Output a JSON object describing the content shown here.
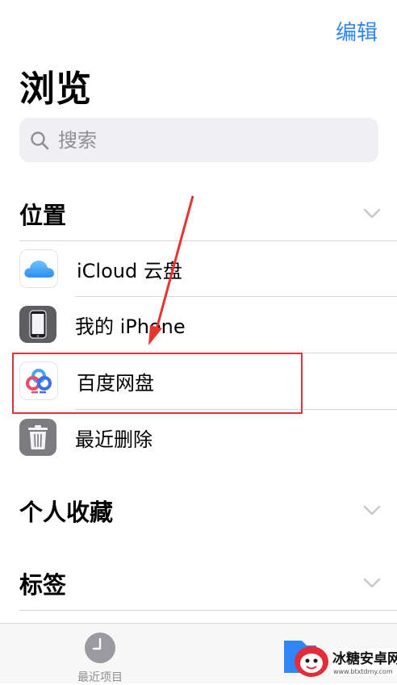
{
  "header": {
    "edit_label": "编辑",
    "title": "浏览"
  },
  "search": {
    "placeholder": "搜索"
  },
  "sections": {
    "locations": {
      "title": "位置",
      "items": [
        {
          "label": "iCloud 云盘",
          "icon": "icloud-icon"
        },
        {
          "label": "我的 iPhone",
          "icon": "iphone-icon"
        },
        {
          "label": "百度网盘",
          "icon": "baidu-netdisk-icon"
        },
        {
          "label": "最近删除",
          "icon": "trash-icon"
        }
      ]
    },
    "favorites": {
      "title": "个人收藏"
    },
    "tags": {
      "title": "标签"
    }
  },
  "tab_bar": {
    "recent_label": "最近项目"
  },
  "watermark": {
    "brand": "冰糖安卓网",
    "url": "www.btxtdmy.com"
  },
  "colors": {
    "accent": "#2f86f6",
    "highlight": "#d9363e",
    "annotation_arrow": "#e8342f"
  }
}
